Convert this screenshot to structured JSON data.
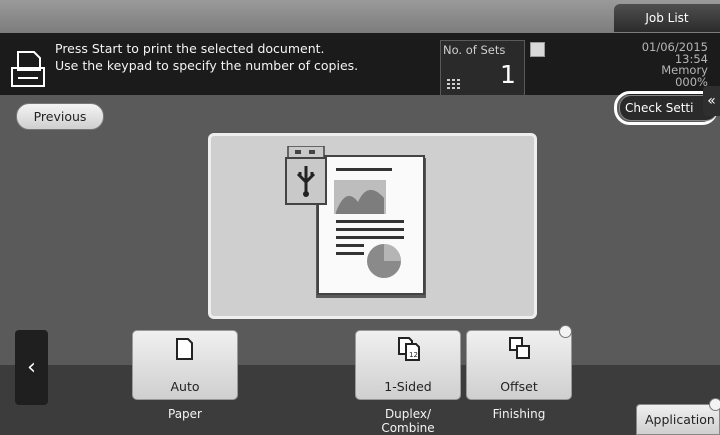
{
  "header": {
    "job_list_label": "Job List",
    "message": "Press Start to print the selected document.\nUse the keypad to specify the number of copies.",
    "sets_label": "No. of Sets",
    "sets_value": "1",
    "date": "01/06/2015",
    "time": "13:54",
    "memory_label": "Memory",
    "memory_value": "000%"
  },
  "nav": {
    "previous_label": "Previous",
    "check_settings_label": "Check Setti"
  },
  "settings": [
    {
      "value": "Auto",
      "label": "Paper",
      "icon": "paper-icon"
    },
    {
      "value": "1-Sided",
      "label": "Duplex/\nCombine",
      "icon": "duplex-icon"
    },
    {
      "value": "Offset",
      "label": "Finishing",
      "icon": "offset-icon"
    }
  ],
  "footer": {
    "application_label": "Application"
  },
  "colors": {
    "message_bar": "#1b1b1b",
    "preview_bg": "#cfcfcf",
    "tile_bg": "#e6e6e6"
  }
}
